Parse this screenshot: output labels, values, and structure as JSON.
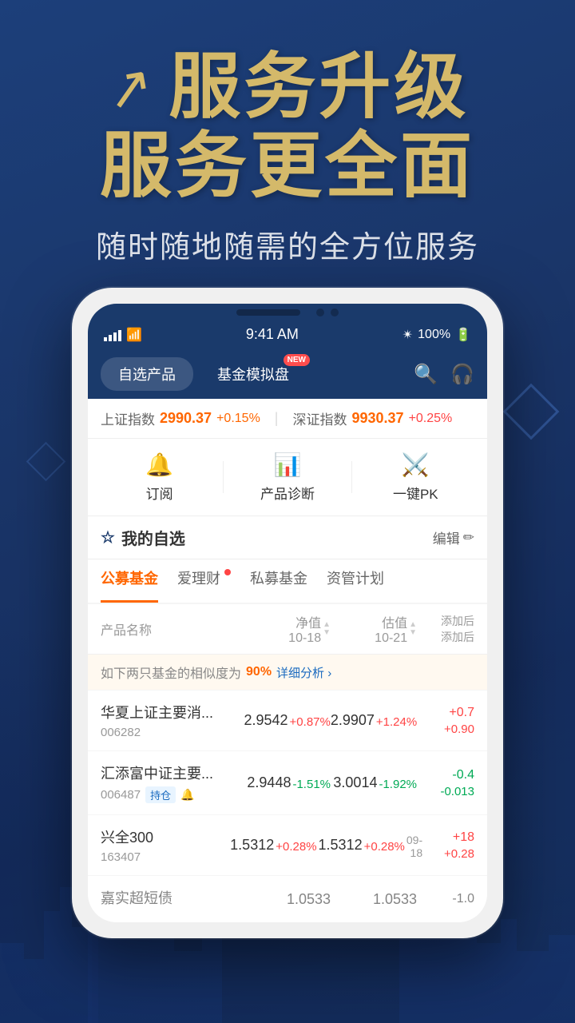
{
  "app": {
    "title": "服务升级",
    "subtitle1": "服务升级",
    "subtitle2": "服务更全面",
    "desc": "随时随地随需的全方位服务"
  },
  "status_bar": {
    "signal": "signal",
    "wifi": "wifi",
    "time": "9:41 AM",
    "bluetooth": "*",
    "battery": "100%"
  },
  "nav": {
    "tab1": "自选产品",
    "tab2": "基金模拟盘",
    "tab2_badge": "NEW",
    "search_icon": "🔍",
    "headset_icon": "🎧"
  },
  "ticker": {
    "label1": "上证指数",
    "value1": "2990.37",
    "change1": "+0.15%",
    "label2": "深证指数",
    "value2": "9930.37",
    "change2": "+0.25%"
  },
  "quick_actions": {
    "action1_icon": "🔔",
    "action1_label": "订阅",
    "action2_icon": "📊",
    "action2_label": "产品诊断",
    "action3_icon": "⚔",
    "action3_label": "一键PK"
  },
  "watchlist": {
    "title": "我的自选",
    "icon": "☆",
    "edit_label": "编辑"
  },
  "categories": {
    "cat1": "公募基金",
    "cat2": "爱理财",
    "cat3": "私募基金",
    "cat4": "资管计划"
  },
  "table_header": {
    "col1": "产品名称",
    "col2_line1": "净值",
    "col2_line2": "10-18",
    "col3_line1": "估值",
    "col3_line2": "10-21",
    "col4": "添加后\n添加后"
  },
  "similarity": {
    "text": "如下两只基金的相似度为",
    "pct": "90%",
    "link": "详细分析 ›"
  },
  "funds": [
    {
      "name": "华夏上证主要消...",
      "code": "006282",
      "tags": [],
      "nav_value": "2.9542",
      "nav_change": "+0.87%",
      "nav_change_dir": "up",
      "est_value": "2.9907",
      "est_change": "+1.24%",
      "est_change_dir": "up",
      "add_value": "+0.7",
      "add_sub": "+0.90"
    },
    {
      "name": "汇添富中证主要...",
      "code": "006487",
      "tags": [
        "持仓"
      ],
      "has_bell": true,
      "nav_value": "2.9448",
      "nav_change": "-1.51%",
      "nav_change_dir": "down",
      "est_value": "3.0014",
      "est_change": "-1.92%",
      "est_change_dir": "down",
      "add_value": "-0.4",
      "add_sub": "-0.013"
    },
    {
      "name": "兴全300",
      "code": "163407",
      "tags": [],
      "nav_value": "1.5312",
      "nav_change": "+0.28%",
      "nav_change_dir": "up",
      "nav_date": "09-18",
      "est_value": "1.5312",
      "est_change": "+0.28%",
      "est_change_dir": "up",
      "add_value": "+18",
      "add_sub": "+0.28"
    },
    {
      "name": "嘉实超短债",
      "code": "",
      "partial": true,
      "nav_value": "1.0533",
      "est_value": "1.0533",
      "add_value": "-1.0"
    }
  ]
}
